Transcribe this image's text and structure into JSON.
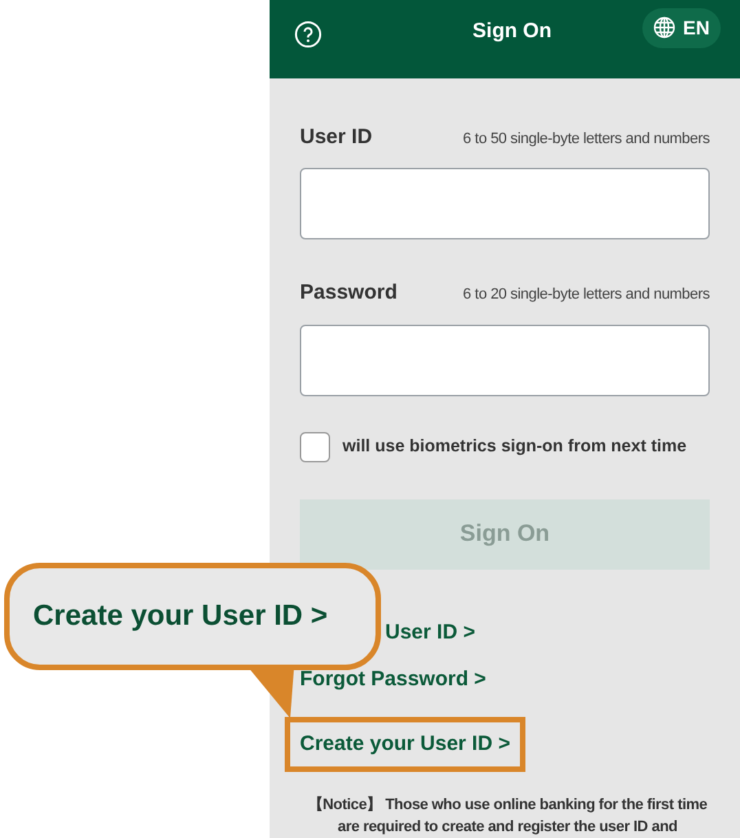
{
  "header": {
    "title": "Sign On",
    "language": "EN"
  },
  "fields": [
    {
      "label": "User ID",
      "hint": "6 to 50 single-byte letters and numbers"
    },
    {
      "label": "Password",
      "hint": "6 to 20 single-byte letters and numbers"
    }
  ],
  "biometrics": {
    "label": "will use biometrics sign-on from next time",
    "checked": false
  },
  "sign_on_button": {
    "label": "Sign On",
    "disabled": true
  },
  "links": [
    {
      "label": "User ID >",
      "partly_covered": true,
      "highlighted": false
    },
    {
      "label": "Forgot Password >",
      "partly_covered": false,
      "highlighted": false
    },
    {
      "label": "Create your User ID >",
      "partly_covered": false,
      "highlighted": true
    }
  ],
  "notice": "【Notice】 Those who use online banking for the first time are required to create and register the user ID and",
  "callout": {
    "text": "Create your User ID >"
  }
}
